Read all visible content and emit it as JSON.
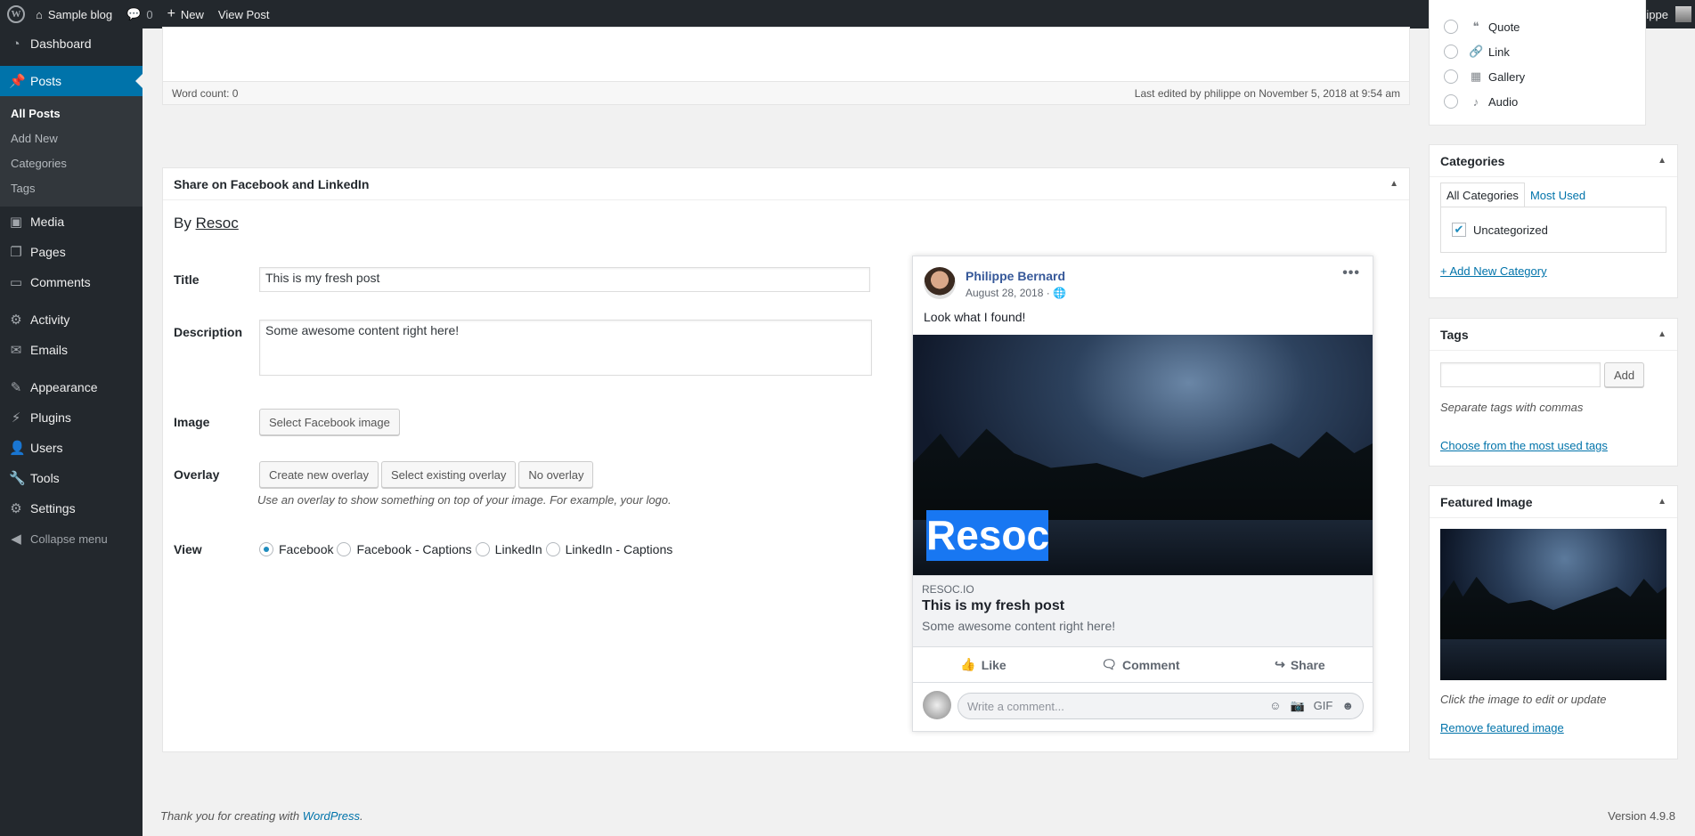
{
  "adminbar": {
    "site": "Sample blog",
    "comments": "0",
    "new": "New",
    "view": "View Post",
    "notif": "0",
    "howdy": "Howdy, philippe"
  },
  "menu": {
    "dashboard": "Dashboard",
    "posts": "Posts",
    "posts_sub": [
      "All Posts",
      "Add New",
      "Categories",
      "Tags"
    ],
    "media": "Media",
    "pages": "Pages",
    "comments": "Comments",
    "activity": "Activity",
    "emails": "Emails",
    "appearance": "Appearance",
    "plugins": "Plugins",
    "users": "Users",
    "tools": "Tools",
    "settings": "Settings",
    "collapse": "Collapse menu"
  },
  "editor": {
    "word_count": "Word count: 0",
    "last_edited": "Last edited by philippe on November 5, 2018 at 9:54 am"
  },
  "share": {
    "title": "Share on Facebook and LinkedIn",
    "by": "By",
    "by_link": "Resoc",
    "labels": {
      "title": "Title",
      "description": "Description",
      "image": "Image",
      "overlay": "Overlay",
      "view": "View"
    },
    "title_value": "This is my fresh post",
    "description_value": "Some awesome content right here!",
    "select_image": "Select Facebook image",
    "overlay_create": "Create new overlay",
    "overlay_existing": "Select existing overlay",
    "overlay_none": "No overlay",
    "overlay_hint": "Use an overlay to show something on top of your image. For example, your logo.",
    "views": [
      "Facebook",
      "Facebook - Captions",
      "LinkedIn",
      "LinkedIn - Captions"
    ],
    "selected_view": "Facebook"
  },
  "fb": {
    "name": "Philippe Bernard",
    "date": "August 28, 2018 ·",
    "message": "Look what I found!",
    "overlay_text": "Resoc",
    "site": "RESOC.IO",
    "title": "This is my fresh post",
    "desc": "Some awesome content right here!",
    "like": "Like",
    "comment": "Comment",
    "share": "Share",
    "comment_placeholder": "Write a comment..."
  },
  "formats": [
    "Quote",
    "Link",
    "Gallery",
    "Audio"
  ],
  "categories": {
    "title": "Categories",
    "tab_all": "All Categories",
    "tab_used": "Most Used",
    "item": "Uncategorized",
    "add": "+ Add New Category"
  },
  "tags": {
    "title": "Tags",
    "add": "Add",
    "hint": "Separate tags with commas",
    "choose": "Choose from the most used tags"
  },
  "featured": {
    "title": "Featured Image",
    "hint": "Click the image to edit or update",
    "remove": "Remove featured image"
  },
  "footer": {
    "thanks": "Thank you for creating with",
    "wp": "WordPress",
    "version": "Version 4.9.8"
  }
}
